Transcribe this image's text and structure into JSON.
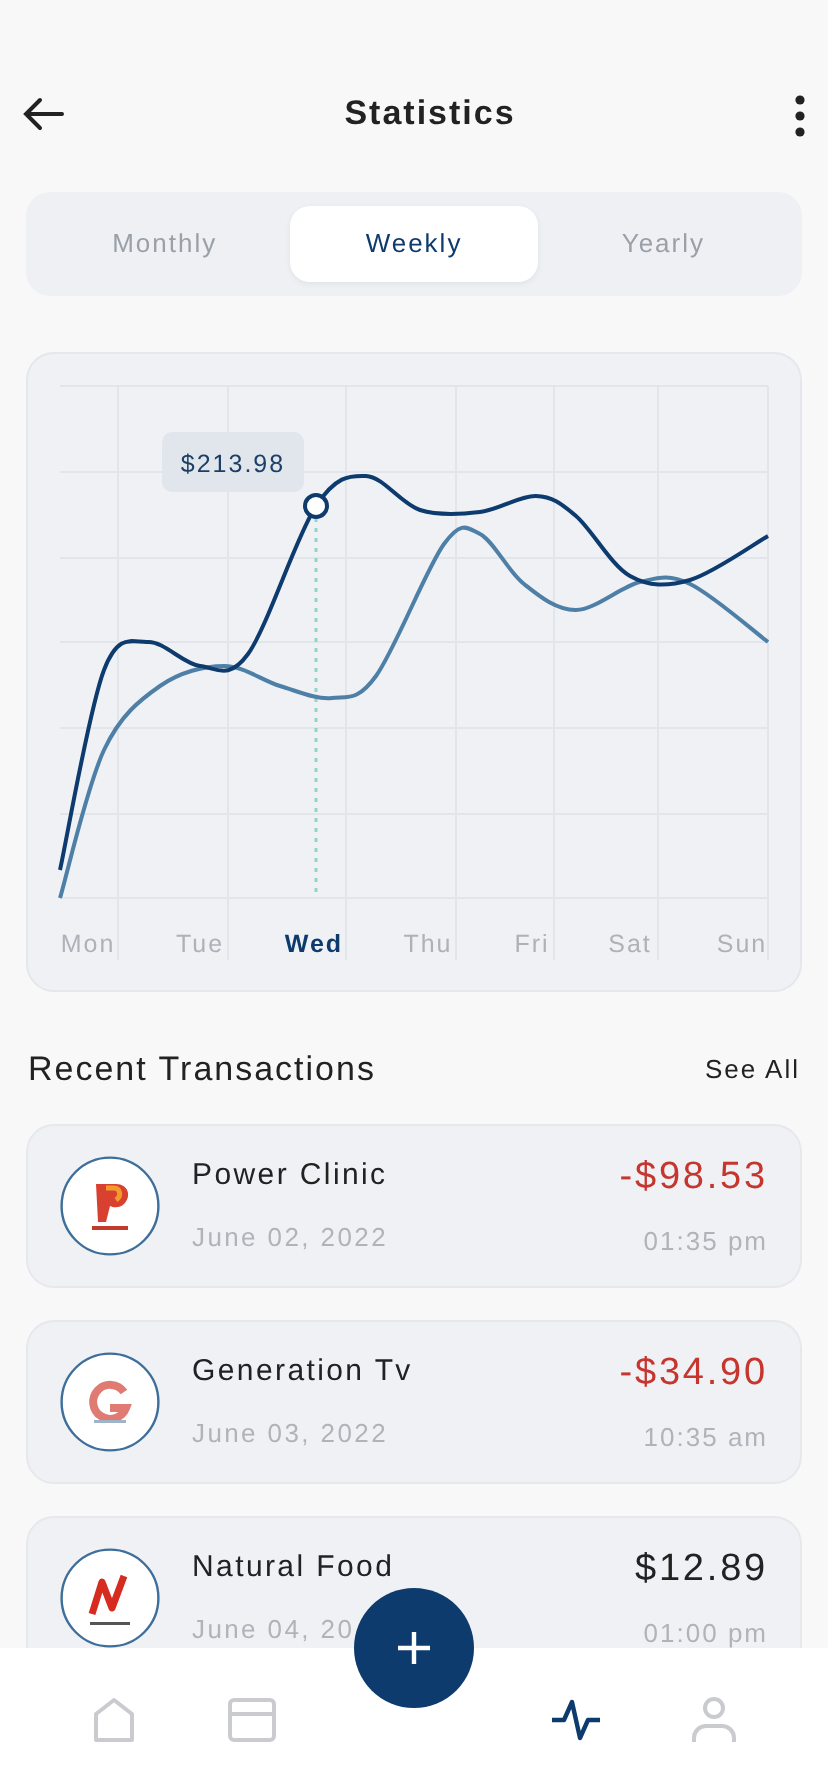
{
  "header": {
    "title": "Statistics"
  },
  "periods": [
    {
      "label": "Monthly",
      "selected": false
    },
    {
      "label": "Weekly",
      "selected": true
    },
    {
      "label": "Yearly",
      "selected": false
    }
  ],
  "chart": {
    "tooltip": "$213.98",
    "days": [
      {
        "label": "Mon",
        "selected": false
      },
      {
        "label": "Tue",
        "selected": false
      },
      {
        "label": "Wed",
        "selected": true
      },
      {
        "label": "Thu",
        "selected": false
      },
      {
        "label": "Fri",
        "selected": false
      },
      {
        "label": "Sat",
        "selected": false
      },
      {
        "label": "Sun",
        "selected": false
      }
    ]
  },
  "transactions": {
    "title": "Recent Transactions",
    "see_all": "See All",
    "items": [
      {
        "kind": "p",
        "name": "Power Clinic",
        "date": "June 02, 2022",
        "amount": "-$98.53",
        "time": "01:35 pm",
        "negative": true
      },
      {
        "kind": "g",
        "name": "Generation Tv",
        "date": "June 03, 2022",
        "amount": "-$34.90",
        "time": "10:35 am",
        "negative": true
      },
      {
        "kind": "n",
        "name": "Natural Food",
        "date": "June 04, 20",
        "amount": "$12.89",
        "time": "01:00 pm",
        "negative": false
      }
    ]
  },
  "nav": [
    {
      "kind": "home",
      "selected": false
    },
    {
      "kind": "card",
      "selected": false
    },
    {
      "kind": "add",
      "selected": false
    },
    {
      "kind": "activity",
      "selected": true
    },
    {
      "kind": "profile",
      "selected": false
    }
  ]
}
